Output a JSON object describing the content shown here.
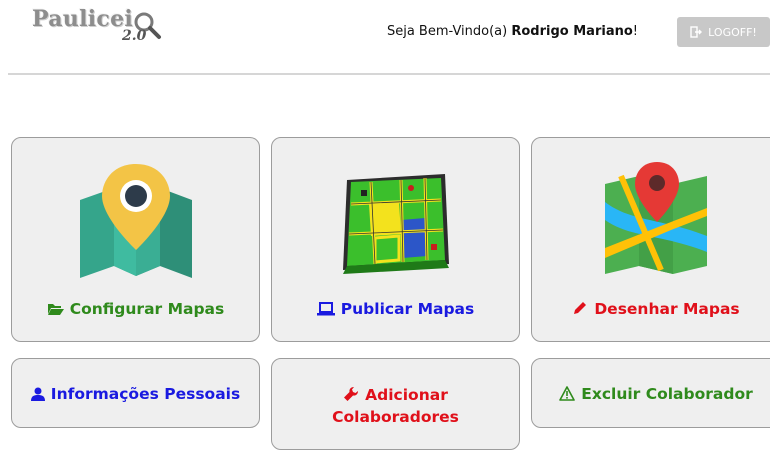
{
  "header": {
    "logo_text": "Paulicei",
    "logo_version": "2.0",
    "welcome_prefix": "Seja Bem-Vindo(a) ",
    "user_name": "Rodrigo Mariano",
    "welcome_suffix": "!",
    "logoff_label": "LOGOFF!"
  },
  "cards": {
    "configurar": {
      "label": "Configurar Mapas",
      "icon": "folder-open-icon",
      "color": "#2f8a1c"
    },
    "publicar": {
      "label": "Publicar Mapas",
      "icon": "laptop-icon",
      "color": "#1a1ae0"
    },
    "desenhar": {
      "label": "Desenhar Mapas",
      "icon": "pencil-icon",
      "color": "#e0101a"
    },
    "informacoes": {
      "label": "Informações Pessoais",
      "icon": "user-icon",
      "color": "#1a1ae0"
    },
    "adicionar": {
      "label_line1": "Adicionar",
      "label_line2": "Colaboradores",
      "icon": "wrench-icon",
      "color": "#e0101a"
    },
    "excluir": {
      "label": "Excluir Colaborador",
      "icon": "warning-icon",
      "color": "#2f8a1c"
    }
  }
}
